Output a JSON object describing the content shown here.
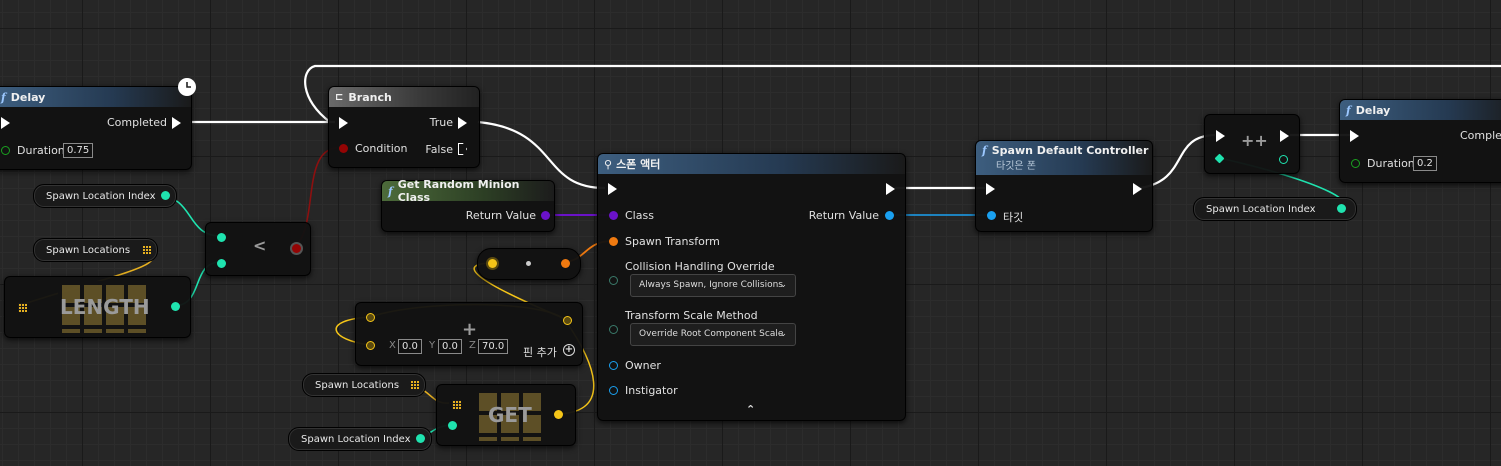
{
  "nodes": {
    "delay_left": {
      "title": "Delay",
      "completed": "Completed",
      "duration_label": "Duration",
      "duration_value": "0.75"
    },
    "branch": {
      "title": "Branch",
      "condition": "Condition",
      "true_label": "True",
      "false_label": "False"
    },
    "get_random": {
      "title": "Get Random Minion Class",
      "return_value": "Return Value"
    },
    "spawn_actor": {
      "title": "스폰 액터",
      "class_label": "Class",
      "return_value": "Return Value",
      "spawn_transform": "Spawn Transform",
      "collision_label": "Collision Handling Override",
      "collision_value": "Always Spawn, Ignore Collisions",
      "scale_label": "Transform Scale Method",
      "scale_value": "Override Root Component Scale",
      "owner": "Owner",
      "instigator": "Instigator"
    },
    "spawn_controller": {
      "title": "Spawn Default Controller",
      "subtitle": "타깃은 폰",
      "target": "타깃"
    },
    "increment": {
      "symbol": "++"
    },
    "delay_right": {
      "title": "Delay",
      "completed": "Complete",
      "duration_label": "Duration",
      "duration_value": "0.2"
    },
    "less": {
      "symbol": "<"
    },
    "length": {
      "label": "LENGTH"
    },
    "get": {
      "label": "GET"
    },
    "make_vector": {
      "x_label": "X",
      "x_value": "0.0",
      "y_label": "Y",
      "y_value": "0.0",
      "z_label": "Z",
      "z_value": "70.0",
      "add_pin": "핀 추가"
    }
  },
  "variables": {
    "spawn_location_index_1": "Spawn Location Index",
    "spawn_locations_1": "Spawn Locations",
    "spawn_locations_2": "Spawn Locations",
    "spawn_location_index_2": "Spawn Location Index",
    "spawn_location_index_3": "Spawn Location Index"
  },
  "colors": {
    "exec": "#ffffff",
    "integer": "#1fe3af",
    "bool": "#940404",
    "class": "#6a12c8",
    "struct": "#f07a10",
    "object": "#1aa0f0",
    "vector": "#f5c518",
    "array": "#e6b020"
  },
  "icons": {
    "clock": "clock-icon",
    "function": "function-icon",
    "branch": "branch-icon",
    "spawn": "spawn-actor-icon",
    "add_pin": "plus-circle-icon",
    "collapse": "chevron-up-icon",
    "dropdown": "chevron-down-icon",
    "array_grid": "array-grid-icon"
  }
}
